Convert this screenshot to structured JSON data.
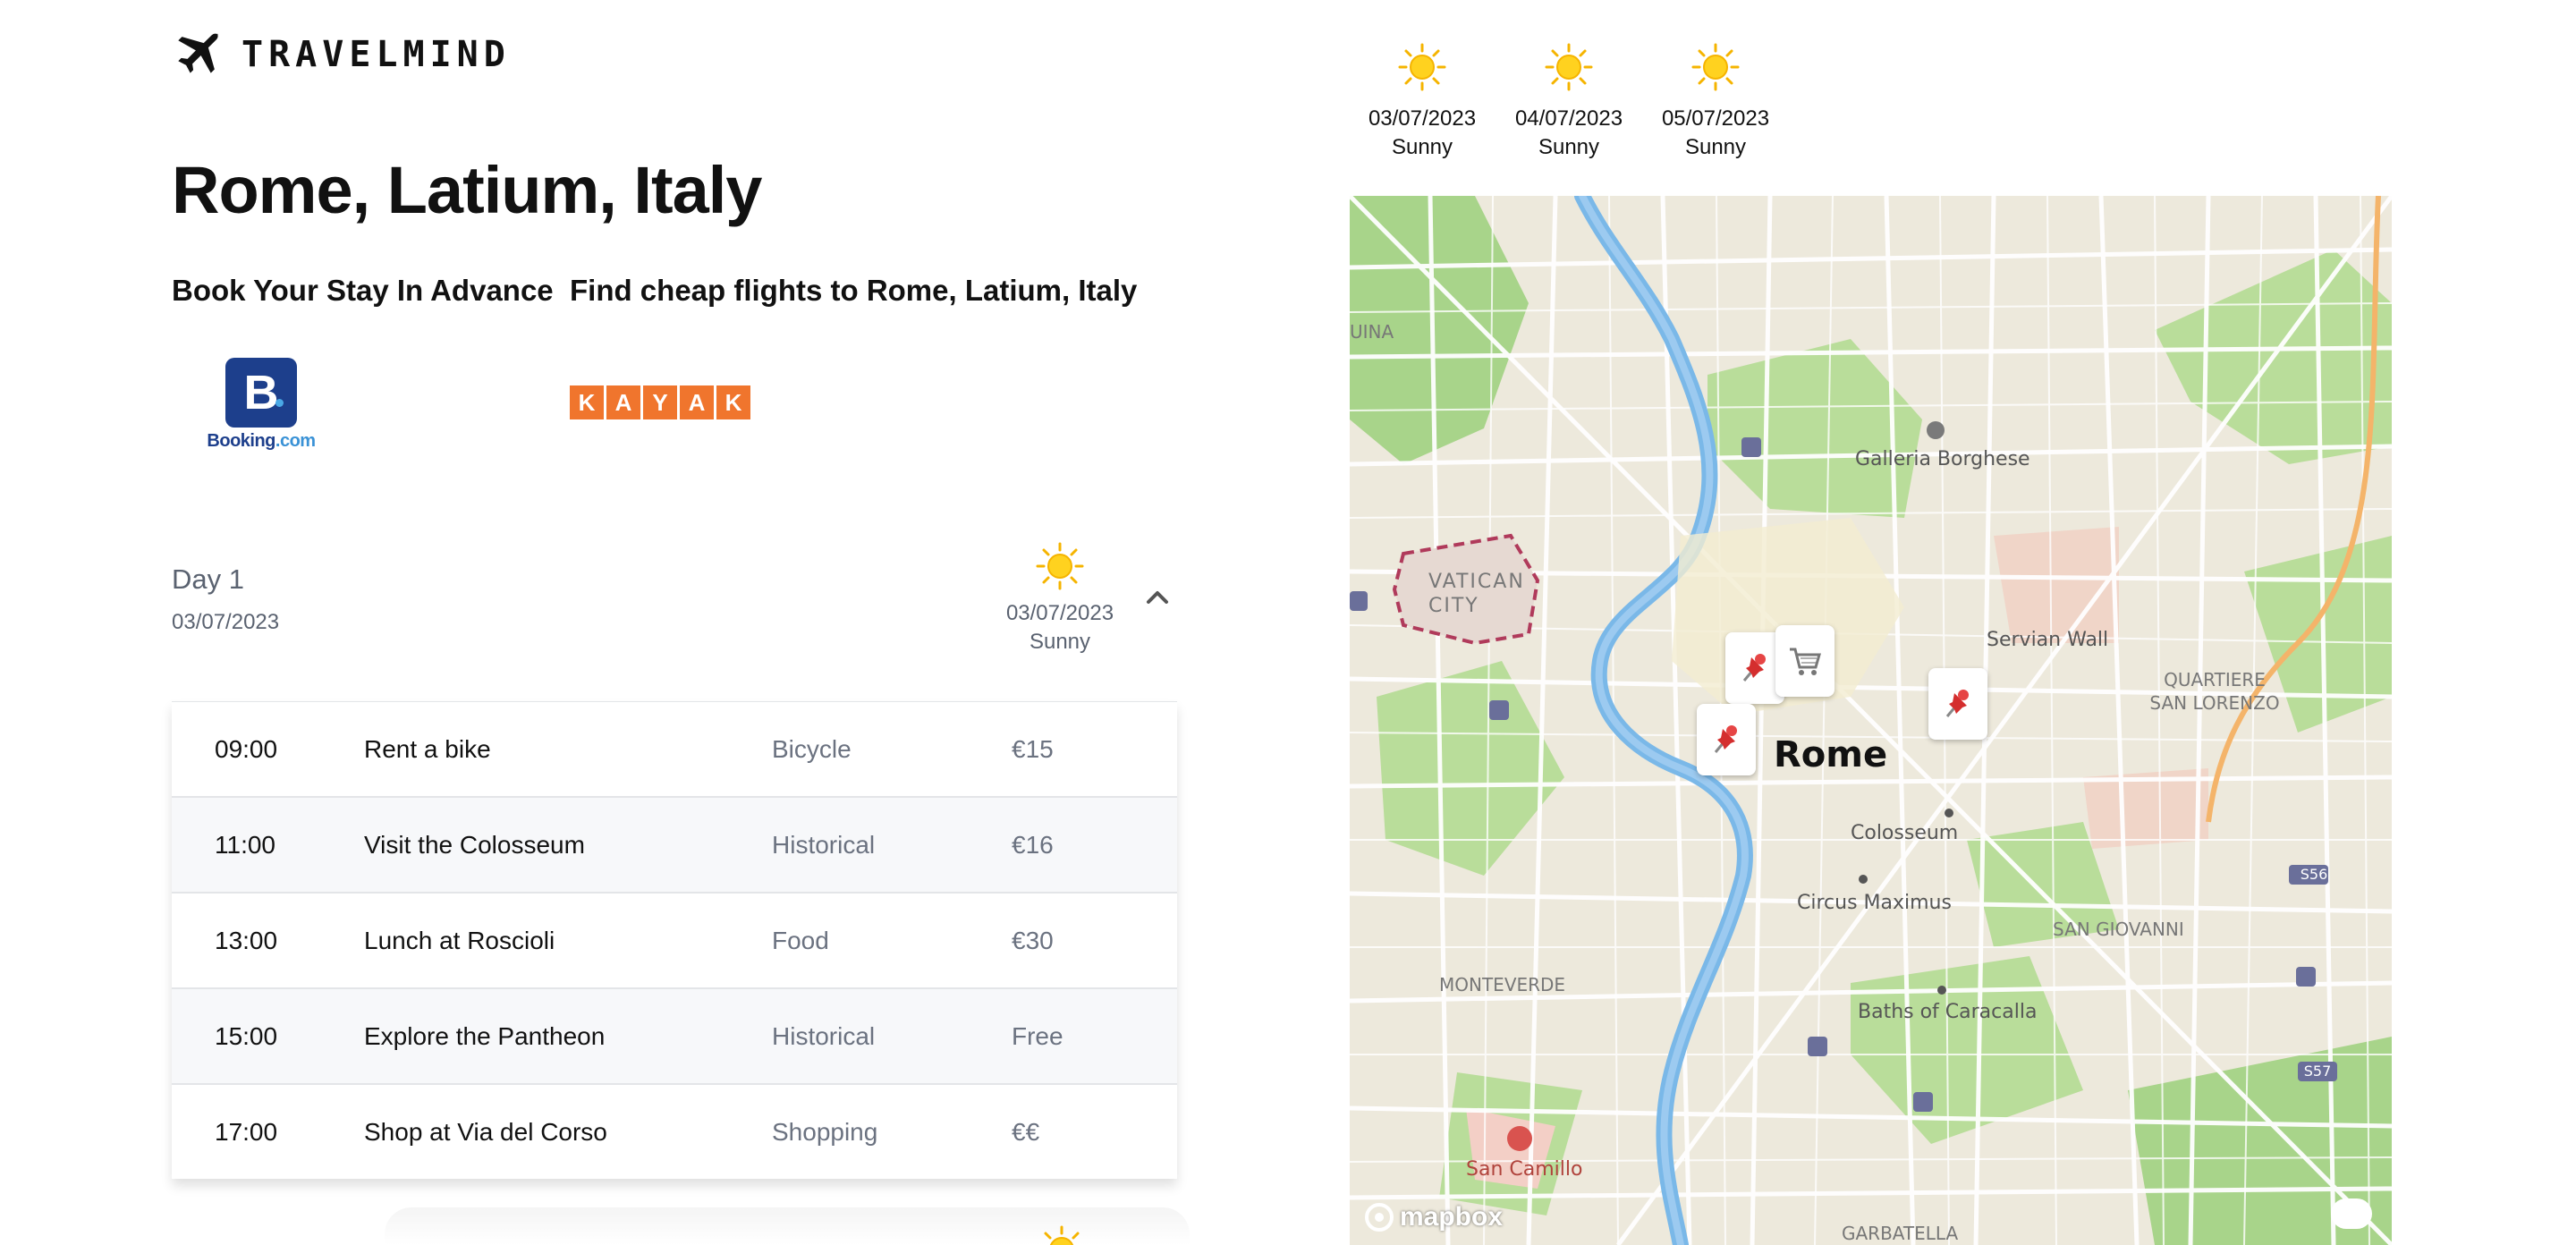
{
  "brand": {
    "name": "TRAVELMIND",
    "icon": "airplane-icon"
  },
  "destination": {
    "title": "Rome, Latium, Italy"
  },
  "booking": {
    "heading": "Book Your Stay In Advance",
    "logo_letter": "B",
    "logo_text_main": "Booking",
    "logo_text_suffix": ".com"
  },
  "flights": {
    "heading": "Find cheap flights to Rome, Latium, Italy",
    "logo_letters": [
      "K",
      "A",
      "Y",
      "A",
      "K"
    ]
  },
  "forecast": [
    {
      "date": "03/07/2023",
      "condition": "Sunny",
      "icon": "sun-icon"
    },
    {
      "date": "04/07/2023",
      "condition": "Sunny",
      "icon": "sun-icon"
    },
    {
      "date": "05/07/2023",
      "condition": "Sunny",
      "icon": "sun-icon"
    }
  ],
  "day": {
    "title": "Day 1",
    "date": "03/07/2023",
    "weather": {
      "date": "03/07/2023",
      "condition": "Sunny",
      "icon": "sun-icon"
    },
    "toggle_icon": "chevron-up-icon",
    "activities": [
      {
        "time": "09:00",
        "activity": "Rent a bike",
        "category": "Bicycle",
        "price": "€15"
      },
      {
        "time": "11:00",
        "activity": "Visit the Colosseum",
        "category": "Historical",
        "price": "€16"
      },
      {
        "time": "13:00",
        "activity": "Lunch at Roscioli",
        "category": "Food",
        "price": "€30"
      },
      {
        "time": "15:00",
        "activity": "Explore the Pantheon",
        "category": "Historical",
        "price": "Free"
      },
      {
        "time": "17:00",
        "activity": "Shop at Via del Corso",
        "category": "Shopping",
        "price": "€€"
      }
    ]
  },
  "map": {
    "labels": {
      "city": "Rome",
      "galleria": "Galleria Borghese",
      "vatican": "VATICAN CITY",
      "servian": "Servian Wall",
      "quartiere": "QUARTIERE SAN LORENZO",
      "colosseum": "Colosseum",
      "circus": "Circus Maximus",
      "giovanni": "SAN GIOVANNI",
      "monteverde": "MONTEVERDE",
      "caracalla": "Baths of Caracalla",
      "camillo": "San Camillo",
      "garbatella": "GARBATELLA",
      "prati": "UINA",
      "s56": "S56",
      "s57": "S57"
    },
    "attribution": "mapbox",
    "markers": [
      "pushpin-icon",
      "pushpin-icon",
      "shopping-cart-icon",
      "pushpin-icon"
    ]
  }
}
